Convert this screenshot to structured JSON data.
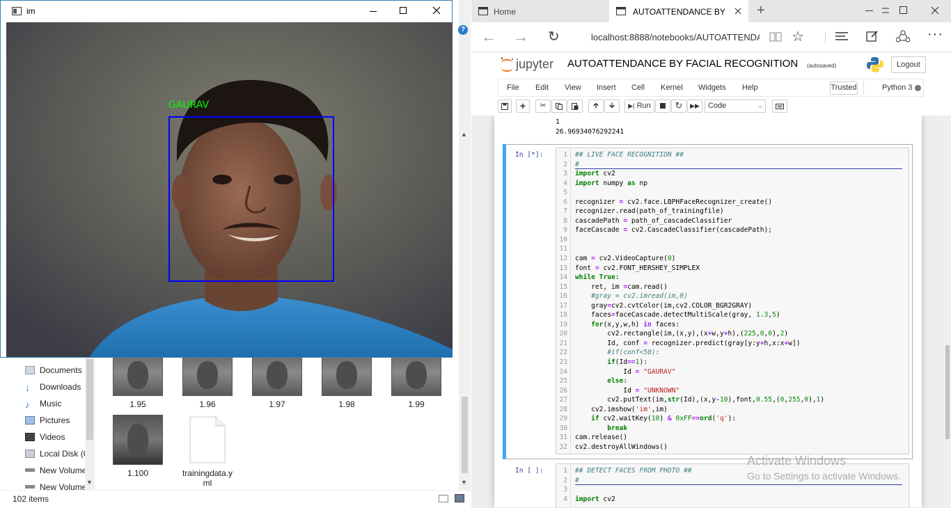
{
  "explorer": {
    "nav_items": [
      {
        "label": "Documents",
        "icon": "documents-icon"
      },
      {
        "label": "Downloads",
        "icon": "downloads-icon"
      },
      {
        "label": "Music",
        "icon": "music-icon"
      },
      {
        "label": "Pictures",
        "icon": "pictures-icon"
      },
      {
        "label": "Videos",
        "icon": "videos-icon"
      },
      {
        "label": "Local Disk (C",
        "icon": "disk-icon"
      },
      {
        "label": "New Volume",
        "icon": "drive-icon"
      },
      {
        "label": "New Volume",
        "icon": "drive-icon"
      }
    ],
    "files": [
      "1.95",
      "1.96",
      "1.97",
      "1.98",
      "1.99",
      "1.100"
    ],
    "yml_file": [
      "trainingdata.y",
      "ml"
    ],
    "status": "102 items"
  },
  "camera_window": {
    "title": "im",
    "face_label": "GAURAV",
    "face_label_color": "#00ff00",
    "box_color": "#0000ff"
  },
  "browser": {
    "tabs": [
      {
        "label": "Home"
      },
      {
        "label": "AUTOATTENDANCE BY F"
      }
    ],
    "url": "localhost:8888/notebooks/AUTOATTENDA",
    "jupyter": {
      "logo": "jupyter",
      "notebook_title": "AUTOATTENDANCE BY FACIAL RECOGNITION",
      "autosaved": "(autosaved)",
      "logout": "Logout",
      "menu": [
        "File",
        "Edit",
        "View",
        "Insert",
        "Cell",
        "Kernel",
        "Widgets",
        "Help"
      ],
      "trusted": "Trusted",
      "kernel": "Python 3",
      "run_label": "Run",
      "cell_type": "Code"
    },
    "output_lines": [
      "1",
      "26.96934076292241"
    ],
    "cell1": {
      "prompt": "In [*]:",
      "line_numbers": [
        "1",
        "2",
        "3",
        "4",
        "5",
        "6",
        "7",
        "8",
        "9",
        "10",
        "11",
        "12",
        "13",
        "14",
        "15",
        "16",
        "17",
        "18",
        "19",
        "20",
        "21",
        "22",
        "23",
        "24",
        "25",
        "26",
        "27",
        "28",
        "29",
        "30",
        "31",
        "32"
      ]
    },
    "cell2": {
      "prompt": "In [ ]:",
      "line_numbers": [
        "1",
        "2",
        "3",
        "4"
      ]
    },
    "watermark": {
      "line1": "Activate Windows",
      "line2": "Go to Settings to activate Windows."
    }
  }
}
